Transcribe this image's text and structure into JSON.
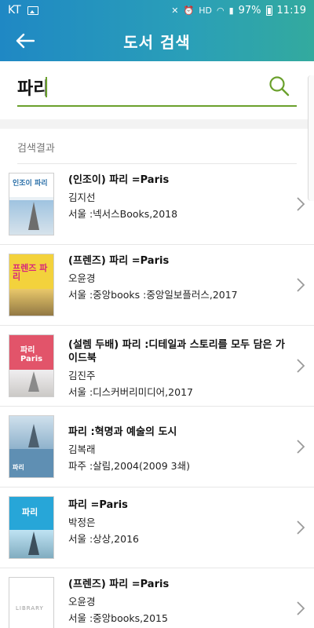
{
  "status_bar": {
    "carrier": "KT",
    "battery": "97%",
    "time": "11:19"
  },
  "header": {
    "title": "도서 검색",
    "back_icon": "arrow-left-icon"
  },
  "search": {
    "value": "파리",
    "search_icon": "search-icon",
    "accent_color": "#6aa02c"
  },
  "results": {
    "label": "검색결과",
    "items": [
      {
        "title": "(인조이) 파리 =Paris",
        "author": "김지선",
        "publisher": "서울 :넥서스Books,2018",
        "cover_text": "인조이 파리"
      },
      {
        "title": "(프렌즈) 파리 =Paris",
        "author": "오윤경",
        "publisher": "서울 :중앙books :중앙일보플러스,2017",
        "cover_text": "프렌즈 파리"
      },
      {
        "title": "(설렘 두배) 파리 :디테일과 스토리를 모두 담은 가이드북",
        "author": "김진주",
        "publisher": "서울 :디스커버리미디어,2017",
        "cover_text": "파리 Paris"
      },
      {
        "title": "파리 :혁명과 예술의 도시",
        "author": "김복래",
        "publisher": "파주 :살림,2004(2009 3쇄)",
        "cover_text": "파리"
      },
      {
        "title": "파리 =Paris",
        "author": "박정은",
        "publisher": "서울 :상상,2016",
        "cover_text": "파리"
      },
      {
        "title": "(프렌즈) 파리 =Paris",
        "author": "오윤경",
        "publisher": "서울 :중앙books,2015",
        "cover_text": "LIBRARY"
      }
    ]
  },
  "theme": {
    "header_gradient_start": "#1f88c4",
    "header_gradient_end": "#33aa9e"
  }
}
